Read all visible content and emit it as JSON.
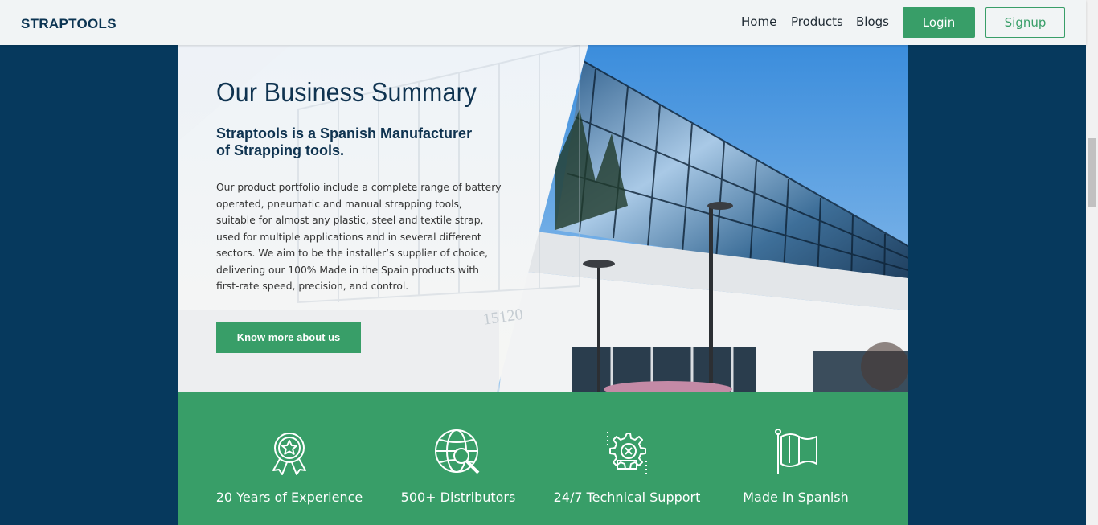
{
  "navbar": {
    "brand": "STRAPTOOLS",
    "links": [
      "Home",
      "Products",
      "Blogs"
    ],
    "login_label": "Login",
    "signup_label": "Signup"
  },
  "summary": {
    "heading": "Our Business Summary",
    "subheading": "Straptools is a Spanish Manufacturer of Strapping tools.",
    "body": "Our product portfolio include a complete range of battery operated, pneumatic and manual strapping tools, suitable for almost any plastic, steel and textile strap, used for multiple applications and in several different sectors. We aim to be the installer’s supplier of choice, delivering our 100% Made in the Spain products with first-rate speed, precision, and control.",
    "button_label": "Know more about us",
    "building_number": "15120"
  },
  "features": [
    {
      "icon": "award-badge-icon",
      "label": "20 Years of Experience"
    },
    {
      "icon": "globe-search-icon",
      "label": "500+ Distributors"
    },
    {
      "icon": "gear-wrench-icon",
      "label": "24/7 Technical Support"
    },
    {
      "icon": "flag-icon",
      "label": "Made in Spanish"
    }
  ],
  "colors": {
    "page_background": "#06395d",
    "accent_green": "#389e68",
    "heading_navy": "#0f3350",
    "navbar_background": "#f1f4f5"
  }
}
